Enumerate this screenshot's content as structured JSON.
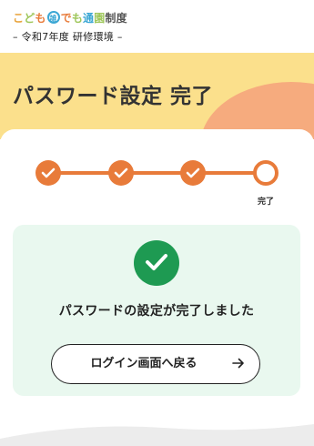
{
  "header": {
    "logo": {
      "parts": [
        {
          "text": "こ",
          "color": "#e8a33a"
        },
        {
          "text": "ど",
          "color": "#9ec65a"
        },
        {
          "text": "も",
          "color": "#e87b3a"
        },
        {
          "text": "誰",
          "color": "#3ba7d4",
          "circled": true
        },
        {
          "text": "で",
          "color": "#e87b3a"
        },
        {
          "text": "も",
          "color": "#9ec65a"
        },
        {
          "text": "通",
          "color": "#3ba7d4"
        },
        {
          "text": "園",
          "color": "#9ec65a"
        },
        {
          "text": "制度",
          "color": "#555555"
        }
      ]
    },
    "subtitle": "– 令和7年度 研修環境 –"
  },
  "hero": {
    "title": "パスワード設定 完了",
    "background": "#fbe08c",
    "accent_blob": "#f6ab7e"
  },
  "stepper": {
    "steps": [
      {
        "state": "done"
      },
      {
        "state": "done"
      },
      {
        "state": "done"
      },
      {
        "state": "current",
        "label": "完了"
      }
    ],
    "color": "#e87b3a"
  },
  "result_card": {
    "background": "#e9f8ef",
    "icon": "check-circle-icon",
    "icon_color": "#1e9a52",
    "message": "パスワードの設定が完了しました",
    "button": {
      "label": "ログイン画面へ戻る",
      "icon": "arrow-right-icon"
    }
  }
}
